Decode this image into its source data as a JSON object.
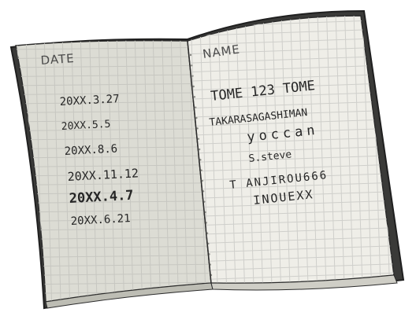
{
  "left_page": {
    "header": "DATE",
    "dates": [
      "20XX.3.27",
      "20XX.5.5",
      "20XX.8.6",
      "20XX.11.12",
      "20XX.4.7",
      "20XX.6.21"
    ]
  },
  "right_page": {
    "header": "NAME",
    "names": [
      "TOME 123 TOME",
      "TAKARASAGASHIMAN",
      "yoccan",
      "S.steve",
      "T ANJIROU666",
      "INOUEXX"
    ]
  },
  "colors": {
    "ink": "#262626",
    "left_page_paper": "#dcdcd4",
    "right_page_paper": "#efeee8",
    "cover_edge": "#2f2f2f",
    "grid": "#c7c7c1"
  }
}
